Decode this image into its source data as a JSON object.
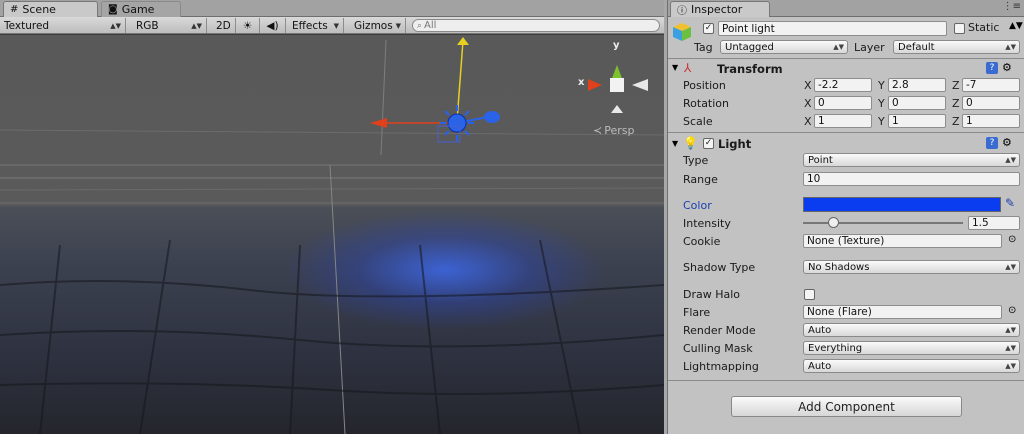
{
  "scene_tabs": {
    "scene": "Scene",
    "game": "Game"
  },
  "scene_toolbar": {
    "draw_mode": "Textured",
    "color_mode": "RGB",
    "mode_2d": "2D",
    "effects": "Effects",
    "gizmos": "Gizmos",
    "search_placeholder": "All"
  },
  "gizmo": {
    "x_label": "x",
    "y_label": "y",
    "persp_label": "Persp"
  },
  "inspector": {
    "tab_title": "Inspector",
    "object_name": "Point light",
    "object_active": true,
    "static_label": "Static",
    "static_checked": false,
    "tag_label": "Tag",
    "tag_value": "Untagged",
    "layer_label": "Layer",
    "layer_value": "Default",
    "transform": {
      "title": "Transform",
      "position_label": "Position",
      "rotation_label": "Rotation",
      "scale_label": "Scale",
      "axis_x": "X",
      "axis_y": "Y",
      "axis_z": "Z",
      "position": {
        "x": "-2.2",
        "y": "2.8",
        "z": "-7"
      },
      "rotation": {
        "x": "0",
        "y": "0",
        "z": "0"
      },
      "scale": {
        "x": "1",
        "y": "1",
        "z": "1"
      }
    },
    "light": {
      "title": "Light",
      "enabled": true,
      "type_label": "Type",
      "type_value": "Point",
      "range_label": "Range",
      "range_value": "10",
      "color_label": "Color",
      "color_value": "#0a3cf0",
      "intensity_label": "Intensity",
      "intensity_value": "1.5",
      "intensity_fraction": 0.19,
      "cookie_label": "Cookie",
      "cookie_value": "None (Texture)",
      "shadow_label": "Shadow Type",
      "shadow_value": "No Shadows",
      "halo_label": "Draw Halo",
      "halo_checked": false,
      "flare_label": "Flare",
      "flare_value": "None (Flare)",
      "render_mode_label": "Render Mode",
      "render_mode_value": "Auto",
      "culling_label": "Culling Mask",
      "culling_value": "Everything",
      "lightmapping_label": "Lightmapping",
      "lightmapping_value": "Auto"
    },
    "add_component": "Add Component"
  },
  "colors": {
    "accent_blue": "#0a3cf0",
    "label_blue": "#1a3fb0",
    "axis_red": "#e0401a",
    "axis_green": "#7cc22a",
    "axis_yellow": "#e8d020"
  }
}
